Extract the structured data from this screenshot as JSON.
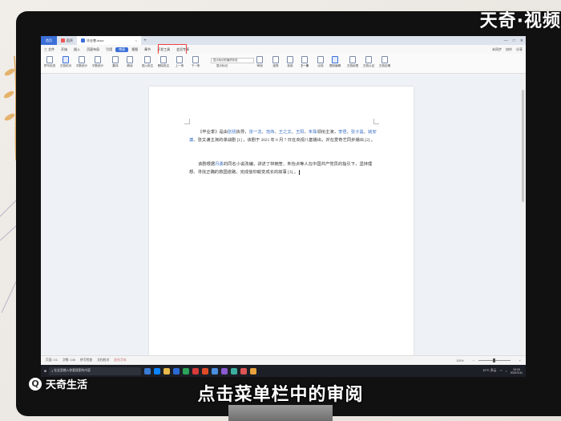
{
  "watermark_top": "天奇·视频",
  "watermark_bottom": "天奇生活",
  "caption": "点击菜单栏中的审阅",
  "titlebar": {
    "home": "首页",
    "tabs": [
      "稻壳",
      "毕业巷.docx"
    ],
    "add": "+"
  },
  "menubar": {
    "items": [
      "三 文件",
      "开始",
      "插入",
      "页面布局",
      "引用",
      "审阅",
      "视图",
      "章节",
      "开发工具",
      "会员专享"
    ],
    "active_index": 5,
    "right": [
      "未同步",
      "协作",
      "分享"
    ]
  },
  "toolbar": {
    "buttons": [
      "拼写检查",
      "文档校对",
      "字数统计",
      "字数统计",
      "翻译",
      "朗读",
      "插入批注",
      "删除批注",
      "上一条",
      "下一条",
      "显示标记",
      "审阅",
      "接受",
      "拒绝",
      "上一条",
      "下一条",
      "比较",
      "限制编辑",
      "文档权限",
      "文档认证",
      "文档定稿"
    ],
    "dropdown": "显示标记的最终状态"
  },
  "document": {
    "para1": [
      {
        "t": "《毕业季》是由",
        "link": false
      },
      {
        "t": "张扬",
        "link": true
      },
      {
        "t": "执导，",
        "link": false
      },
      {
        "t": "张一龙",
        "link": true
      },
      {
        "t": "、",
        "link": false
      },
      {
        "t": "范炜",
        "link": true
      },
      {
        "t": "、",
        "link": false
      },
      {
        "t": "王之文",
        "link": true
      },
      {
        "t": "、",
        "link": false
      },
      {
        "t": "王阳",
        "link": true
      },
      {
        "t": "、",
        "link": false
      },
      {
        "t": "朱珠",
        "link": true
      },
      {
        "t": "领衔主演，",
        "link": false
      },
      {
        "t": "李悟",
        "link": true
      },
      {
        "t": "、",
        "link": false
      },
      {
        "t": "张子晨",
        "link": true
      },
      {
        "t": "、",
        "link": false
      },
      {
        "t": "姚安濂",
        "link": true
      },
      {
        "t": "、张文谦主演的谍战剧 [1] ，该剧于 2021 年 6 月 7 日在央视八套播出，并在爱奇艺同步播出 [2] 。",
        "link": false
      }
    ],
    "para2": [
      {
        "t": "该剧根据",
        "link": false
      },
      {
        "t": "丹勇",
        "link": true
      },
      {
        "t": "的同名小说改编，讲述了林楠笙、朱怡贞等人在中国共产党员的指引下，坚持理想、寻找正确的救国道路，完成信仰蜕变成长的故事 [3] 。",
        "link": false
      }
    ]
  },
  "statusbar": {
    "left": [
      "页面: 1/1",
      "字数: 145",
      "拼写检查",
      "文档校对",
      "缺失字体"
    ],
    "right": [
      "110%",
      "−",
      "+"
    ]
  },
  "taskbar": {
    "search_placeholder": "在这里输入你要搜索的内容",
    "weather": "10°C 多云",
    "time": "19:15",
    "date": "2022/1/11"
  }
}
